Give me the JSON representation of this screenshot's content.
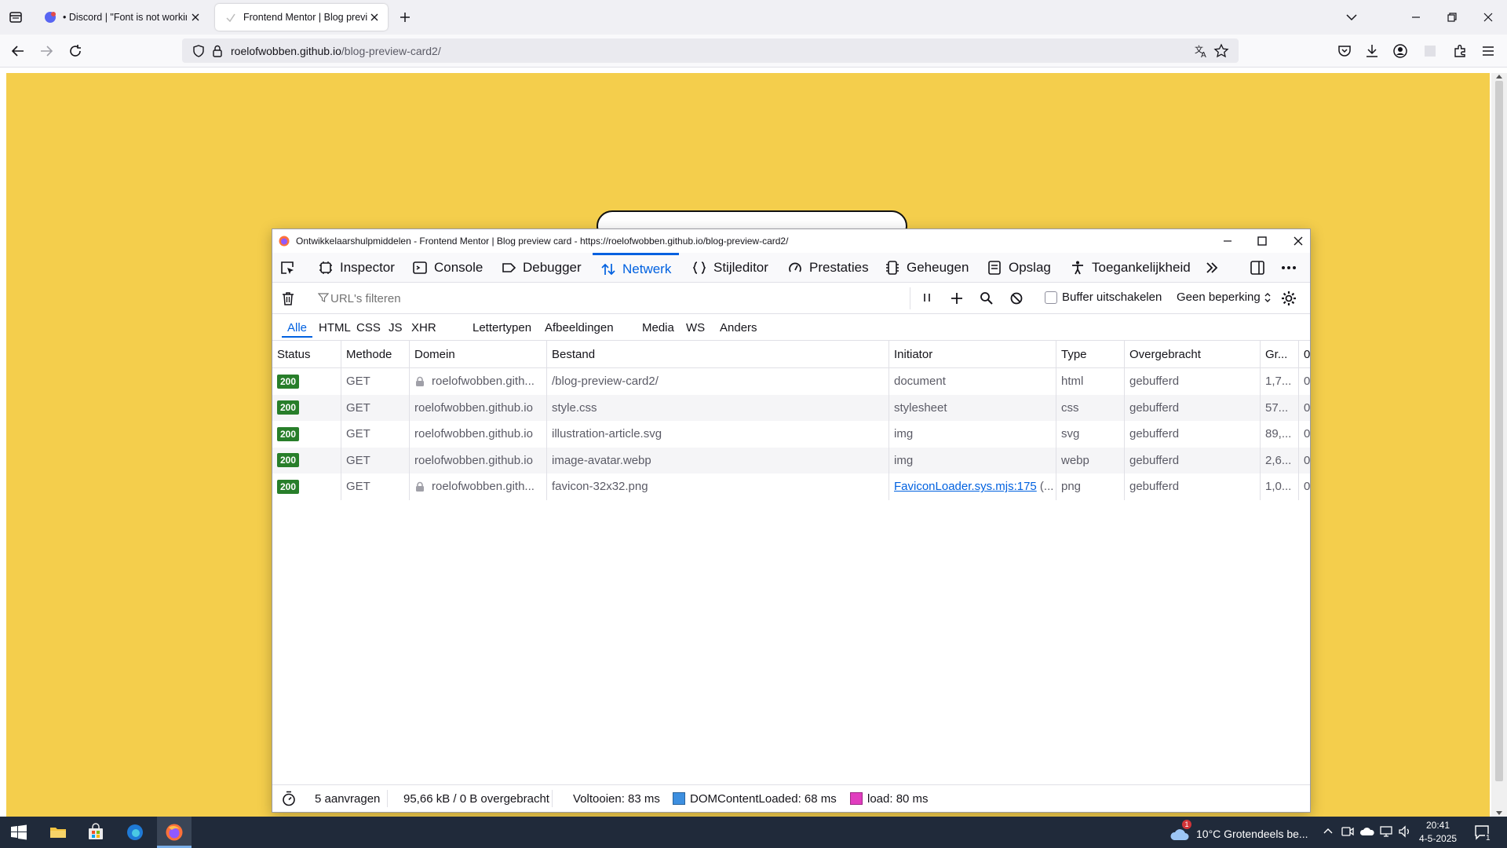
{
  "browser": {
    "tabs": [
      {
        "title": "• Discord | \"Font is not working"
      },
      {
        "title": "Frontend Mentor | Blog preview"
      }
    ],
    "url_host": "roelofwobben.github.io",
    "url_path": "/blog-preview-card2/"
  },
  "devtools": {
    "window_title": "Ontwikkelaarshulpmiddelen - Frontend Mentor | Blog preview card - https://roelofwobben.github.io/blog-preview-card2/",
    "tabs": [
      {
        "label": "Inspector",
        "icon": "inspector-icon"
      },
      {
        "label": "Console",
        "icon": "console-icon"
      },
      {
        "label": "Debugger",
        "icon": "debugger-icon"
      },
      {
        "label": "Netwerk",
        "icon": "network-icon",
        "selected": true
      },
      {
        "label": "Stijleditor",
        "icon": "style-editor-icon"
      },
      {
        "label": "Prestaties",
        "icon": "performance-icon"
      },
      {
        "label": "Geheugen",
        "icon": "memory-icon"
      },
      {
        "label": "Opslag",
        "icon": "storage-icon"
      },
      {
        "label": "Toegankelijkheid",
        "icon": "accessibility-icon"
      }
    ],
    "filter_placeholder": "URL's filteren",
    "buffer_label": "Buffer uitschakelen",
    "throttle_value": "Geen beperking",
    "type_filters": [
      "Alle",
      "HTML",
      "CSS",
      "JS",
      "XHR",
      "Lettertypen",
      "Afbeeldingen",
      "Media",
      "WS",
      "Anders"
    ],
    "columns": [
      "Status",
      "Methode",
      "Domein",
      "Bestand",
      "Initiator",
      "Type",
      "Overgebracht",
      "Gr...",
      "0 "
    ],
    "rows": [
      {
        "status": "200",
        "method": "GET",
        "domain": "roelofwobben.gith...",
        "file": "/blog-preview-card2/",
        "initiator": "document",
        "type": "html",
        "transferred": "gebufferd",
        "size": "1,7...",
        "time": "0"
      },
      {
        "status": "200",
        "method": "GET",
        "domain": "roelofwobben.github.io",
        "file": "style.css",
        "initiator": "stylesheet",
        "type": "css",
        "transferred": "gebufferd",
        "size": "57...",
        "time": "0"
      },
      {
        "status": "200",
        "method": "GET",
        "domain": "roelofwobben.github.io",
        "file": "illustration-article.svg",
        "initiator": "img",
        "type": "svg",
        "transferred": "gebufferd",
        "size": "89,...",
        "time": "0"
      },
      {
        "status": "200",
        "method": "GET",
        "domain": "roelofwobben.github.io",
        "file": "image-avatar.webp",
        "initiator": "img",
        "type": "webp",
        "transferred": "gebufferd",
        "size": "2,6...",
        "time": "0"
      },
      {
        "status": "200",
        "method": "GET",
        "domain": "roelofwobben.gith...",
        "file": "favicon-32x32.png",
        "initiator": "FaviconLoader.sys.mjs:175",
        "initiator_suffix": " (...",
        "type": "png",
        "transferred": "gebufferd",
        "size": "1,0...",
        "time": "0"
      }
    ],
    "status": {
      "requests": "5 aanvragen",
      "transferred": "95,66 kB / 0 B overgebracht",
      "finish": "Voltooien: 83 ms",
      "dcl": "DOMContentLoaded: 68 ms",
      "load": "load: 80 ms"
    },
    "colors": {
      "accent": "#0061e0",
      "status_ok": "#287e2a",
      "dcl": "#3d8fe0",
      "load": "#e13dbf"
    }
  },
  "page_colors": {
    "background": "#f4ce4c"
  },
  "taskbar": {
    "weather": "10°C  Grotendeels be...",
    "weather_badge": "1",
    "time": "20:41",
    "date": "4-5-2025",
    "notification_count": "1"
  }
}
